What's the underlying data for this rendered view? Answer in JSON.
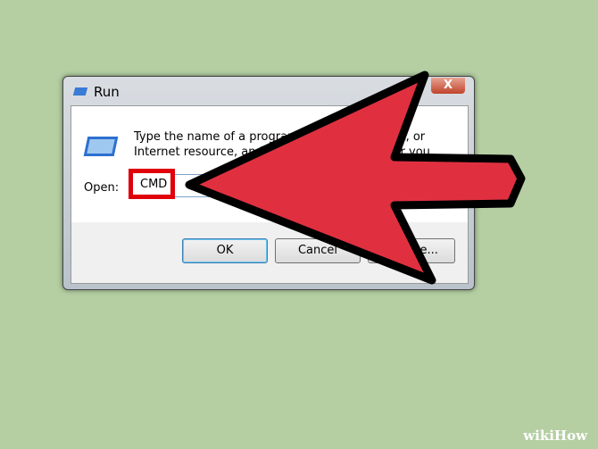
{
  "dialog": {
    "title": "Run",
    "close_label": "X",
    "description": "Type the name of a program, folder, document, or Internet resource, and Windows will open it for you.",
    "open_label": "Open:",
    "open_value": "CMD",
    "ok_label": "OK",
    "cancel_label": "Cancel",
    "browse_label": "Browse..."
  },
  "annotation": {
    "arrow_color": "#e03040",
    "highlight_color": "#e0000a"
  },
  "watermark": "wikiHow"
}
